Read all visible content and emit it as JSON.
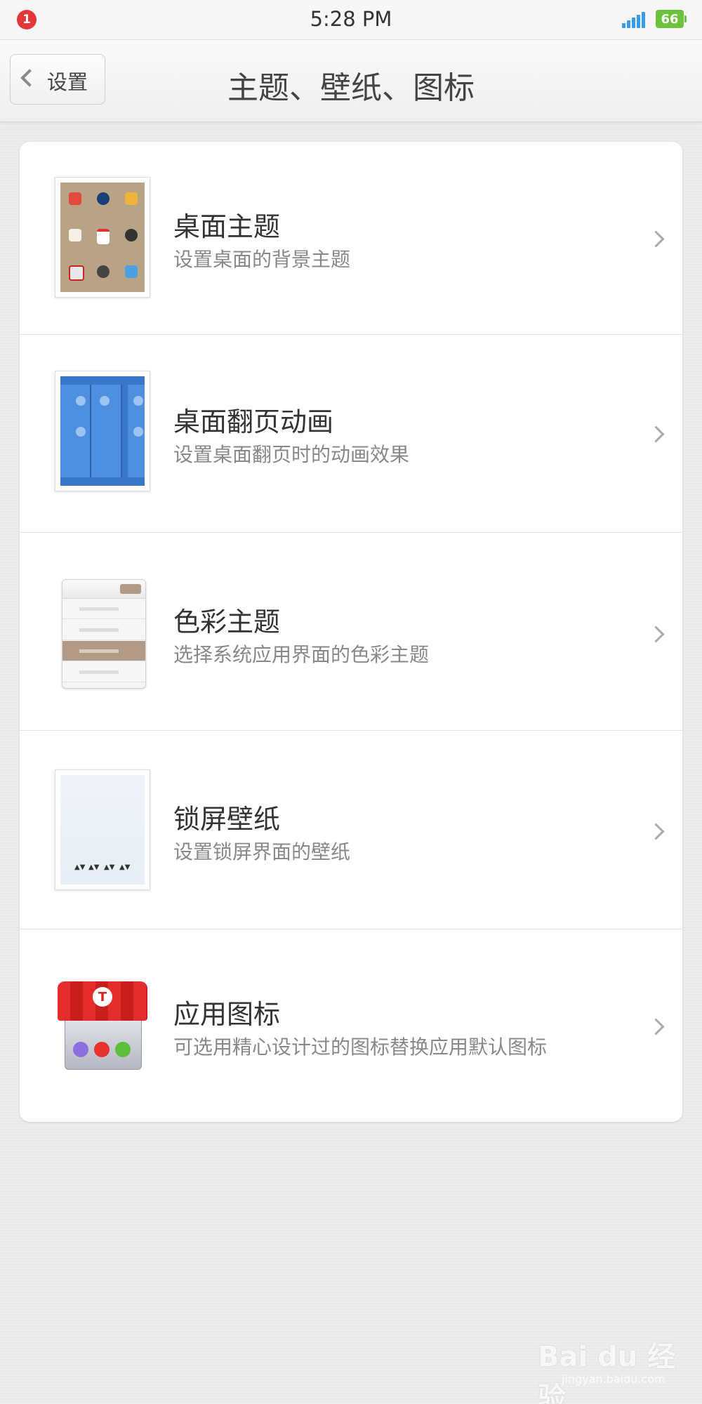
{
  "status_bar": {
    "notification_count": "1",
    "time": "5:28 PM",
    "battery": "66",
    "signal_icon": "signal-bars-icon"
  },
  "nav": {
    "back_label": "设置",
    "title": "主题、壁纸、图标"
  },
  "items": [
    {
      "title": "桌面主题",
      "subtitle": "设置桌面的背景主题",
      "icon": "desktop-theme-thumbnail"
    },
    {
      "title": "桌面翻页动画",
      "subtitle": "设置桌面翻页时的动画效果",
      "icon": "page-turn-thumbnail"
    },
    {
      "title": "色彩主题",
      "subtitle": "选择系统应用界面的色彩主题",
      "icon": "color-theme-thumbnail"
    },
    {
      "title": "锁屏壁纸",
      "subtitle": "设置锁屏界面的壁纸",
      "icon": "lockscreen-wallpaper-thumbnail"
    },
    {
      "title": "应用图标",
      "subtitle": "可选用精心设计过的图标替换应用默认图标",
      "icon": "app-icon-store-icon"
    }
  ],
  "watermark": {
    "brand": "Bai du 经验",
    "url": "jingyan.baidu.com"
  },
  "colors": {
    "background": "#ececec",
    "card": "#ffffff",
    "title_text": "#333333",
    "subtitle_text": "#888888",
    "notification_red": "#e5363a",
    "battery_green": "#6cc23a",
    "signal_blue": "#3a9be8"
  }
}
